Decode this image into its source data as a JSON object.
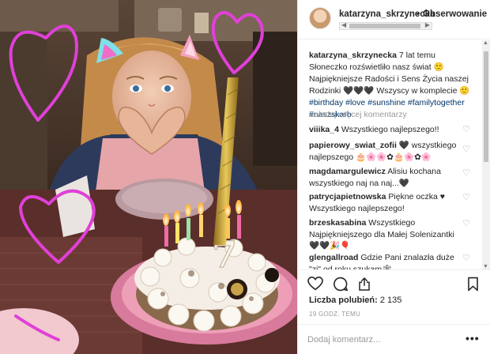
{
  "post": {
    "username": "katarzyna_skrzynecka",
    "separator": "•",
    "follow_label": "Obserwowanie",
    "caption_user": "katarzyna_skrzynecka",
    "caption_text": "7 lat temu Słoneczko rozświetliło nasz świat 🙂 Najpiękniejsze Radości i Sens Życia naszej Rodzinki 🖤🖤🖤 Wszyscy w komplecie 🙂",
    "caption_tags": "#birthday #love #sunshine #familytogether #naszskarb",
    "load_more": "Załaduj więcej komentarzy",
    "comments": [
      {
        "user": "viiika_4",
        "text": "Wszystkiego najlepszego!!"
      },
      {
        "user": "papierowy_swiat_zofii",
        "text": "🖤 wszystkiego najlepszego 🎂🌸🌸✿🎂🌸✿🌸"
      },
      {
        "user": "magdamargulewicz",
        "text": "Alisiu kochana wszystkiego naj na naj...🖤"
      },
      {
        "user": "patrycjapietnowska",
        "text": "Piękne oczka ♥ Wszystkiego najlepszego!"
      },
      {
        "user": "brzeskasabina",
        "text": "Wszystkiego Najpiękniejszego dla Małej Solenizantki🖤🖤🎉🎈"
      },
      {
        "user": "glengallroad",
        "text": "Gdzie Pani znalazła duże \"zi\" od roku szukam🕸"
      }
    ],
    "likes_label": "Liczba polubień:",
    "likes_count": "2 135",
    "timestamp": "19 GODZ. TEMU",
    "comment_placeholder": "Dodaj komentarz...",
    "more_label": "•••"
  },
  "photo": {
    "cake_number": "7"
  },
  "icons": {
    "like": "heart-outline-icon",
    "comment": "comment-bubble-icon",
    "share": "share-icon",
    "save": "bookmark-icon"
  },
  "colors": {
    "doodle_magenta": "#e040d8",
    "link_blue": "#003569",
    "muted_gray": "#999999"
  }
}
